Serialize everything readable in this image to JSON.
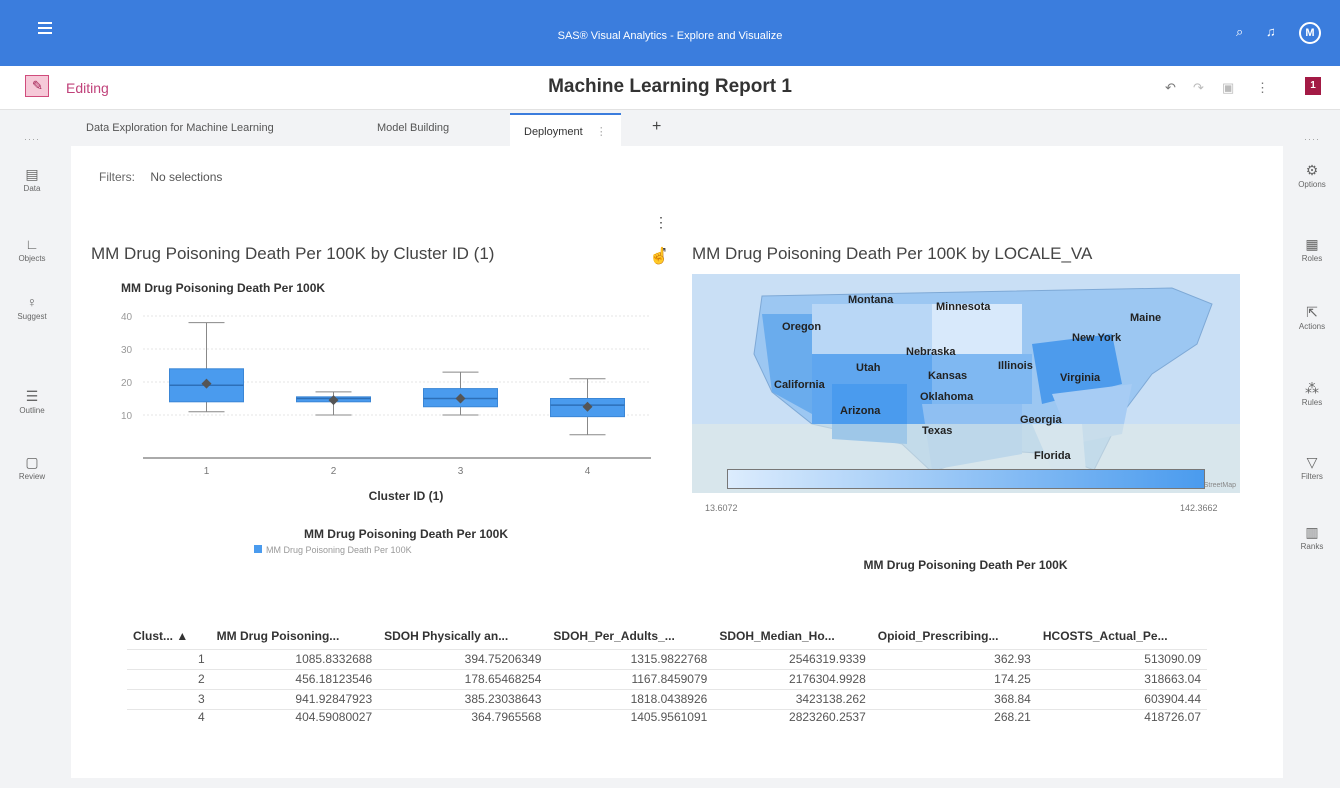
{
  "app": {
    "banner_title": "SAS® Visual Analytics - Explore and Visualize",
    "avatar": "M"
  },
  "header": {
    "status": "Editing",
    "report_title": "Machine Learning Report 1",
    "badge": "1"
  },
  "left_sidebar": [
    {
      "label": "Data",
      "icon": "data-icon"
    },
    {
      "label": "Objects",
      "icon": "objects-icon"
    },
    {
      "label": "Suggest",
      "icon": "suggest-icon"
    },
    {
      "label": "Outline",
      "icon": "outline-icon"
    },
    {
      "label": "Review",
      "icon": "review-icon"
    }
  ],
  "right_sidebar": [
    {
      "label": "Options",
      "icon": "options-icon"
    },
    {
      "label": "Roles",
      "icon": "roles-icon"
    },
    {
      "label": "Actions",
      "icon": "actions-icon"
    },
    {
      "label": "Rules",
      "icon": "rules-icon"
    },
    {
      "label": "Filters",
      "icon": "filters-icon"
    },
    {
      "label": "Ranks",
      "icon": "ranks-icon"
    }
  ],
  "tabs": [
    {
      "label": "Data Exploration for Machine Learning"
    },
    {
      "label": "Model Building"
    },
    {
      "label": "Deployment",
      "active": true
    }
  ],
  "filters": {
    "label": "Filters:",
    "value": "No selections"
  },
  "box_panel": {
    "title": "MM Drug Poisoning Death Per 100K by Cluster ID (1)"
  },
  "map_panel": {
    "title": "MM Drug Poisoning Death Per 100K by LOCALE_VA",
    "states": [
      "Montana",
      "Minnesota",
      "Oregon",
      "Maine",
      "New York",
      "Nebraska",
      "Illinois",
      "Utah",
      "Kansas",
      "Virginia",
      "California",
      "Oklahoma",
      "Arizona",
      "Georgia",
      "Texas",
      "Florida"
    ],
    "attribution": "Map data © OpenStreetMap",
    "legend": {
      "min": "13.6072",
      "max": "142.3662",
      "title": "MM Drug Poisoning Death Per 100K"
    },
    "low_color": "#dcecfd",
    "high_color": "#4a9bee"
  },
  "chart_data": {
    "type": "box",
    "title": "MM Drug Poisoning Death Per 100K",
    "xlabel": "Cluster ID (1)",
    "ylabel": "",
    "categories": [
      "1",
      "2",
      "3",
      "4"
    ],
    "ylim": [
      0,
      40
    ],
    "yticks": [
      10,
      20,
      30,
      40
    ],
    "grid": true,
    "series": [
      {
        "name": "MM Drug Poisoning Death Per 100K",
        "color": "#4a9bee",
        "boxes": [
          {
            "min": 11,
            "q1": 14,
            "median": 19,
            "q3": 24,
            "max": 38,
            "mean": 19.5
          },
          {
            "min": 10,
            "q1": 14,
            "median": 15,
            "q3": 15.5,
            "max": 17,
            "mean": 14.5
          },
          {
            "min": 10,
            "q1": 12.5,
            "median": 15,
            "q3": 18,
            "max": 23,
            "mean": 15
          },
          {
            "min": 4,
            "q1": 9.5,
            "median": 13,
            "q3": 15,
            "max": 21,
            "mean": 12.5
          }
        ]
      }
    ],
    "legend": {
      "title": "MM Drug Poisoning Death Per 100K",
      "item": "MM Drug Poisoning Death Per 100K",
      "position": "bottom"
    }
  },
  "table": {
    "columns": [
      "Clust... ▲",
      "MM Drug Poisoning...",
      "SDOH Physically an...",
      "SDOH_Per_Adults_...",
      "SDOH_Median_Ho...",
      "Opioid_Prescribing...",
      "HCOSTS_Actual_Pe..."
    ],
    "rows": [
      [
        "1",
        "1085.8332688",
        "394.75206349",
        "1315.9822768",
        "2546319.9339",
        "362.93",
        "513090.09"
      ],
      [
        "2",
        "456.18123546",
        "178.65468254",
        "1167.8459079",
        "2176304.9928",
        "174.25",
        "318663.04"
      ],
      [
        "3",
        "941.92847923",
        "385.23038643",
        "1818.0438926",
        "3423138.262",
        "368.84",
        "603904.44"
      ],
      [
        "4",
        "404.59080027",
        "364.7965568",
        "1405.9561091",
        "2823260.2537",
        "268.21",
        "418726.07"
      ]
    ]
  }
}
